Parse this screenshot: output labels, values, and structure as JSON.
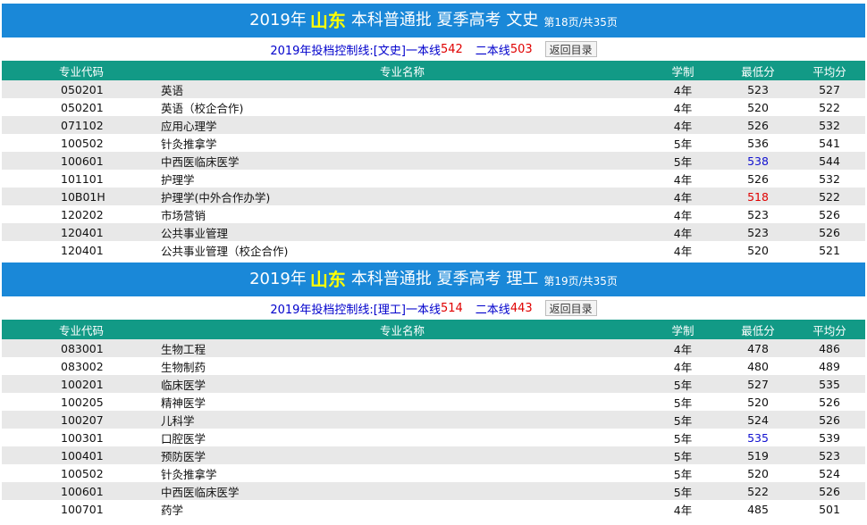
{
  "sections": [
    {
      "title": {
        "year": "2019年",
        "province": "山东",
        "rest": "本科普通批 夏季高考 文史",
        "page_info": "第18页/共35页"
      },
      "control": {
        "label": "2019年投档控制线:",
        "category": "[文史]",
        "line1_label": "一本线",
        "line1_value": "542",
        "line2_label": "二本线",
        "line2_value": "503"
      },
      "back_label": "返回目录",
      "headers": {
        "code": "专业代码",
        "name": "专业名称",
        "years": "学制",
        "min": "最低分",
        "avg": "平均分"
      },
      "rows": [
        {
          "code": "050201",
          "name": "英语",
          "years": "4年",
          "min": "523",
          "avg": "527",
          "min_color": ""
        },
        {
          "code": "050201",
          "name": "英语（校企合作)",
          "years": "4年",
          "min": "520",
          "avg": "522",
          "min_color": ""
        },
        {
          "code": "071102",
          "name": "应用心理学",
          "years": "4年",
          "min": "526",
          "avg": "532",
          "min_color": ""
        },
        {
          "code": "100502",
          "name": "针灸推拿学",
          "years": "5年",
          "min": "536",
          "avg": "541",
          "min_color": ""
        },
        {
          "code": "100601",
          "name": "中西医临床医学",
          "years": "5年",
          "min": "538",
          "avg": "544",
          "min_color": "blue"
        },
        {
          "code": "101101",
          "name": "护理学",
          "years": "4年",
          "min": "526",
          "avg": "532",
          "min_color": ""
        },
        {
          "code": "10B01H",
          "name": "护理学(中外合作办学)",
          "years": "4年",
          "min": "518",
          "avg": "522",
          "min_color": "red"
        },
        {
          "code": "120202",
          "name": "市场营销",
          "years": "4年",
          "min": "523",
          "avg": "526",
          "min_color": ""
        },
        {
          "code": "120401",
          "name": "公共事业管理",
          "years": "4年",
          "min": "523",
          "avg": "526",
          "min_color": ""
        },
        {
          "code": "120401",
          "name": "公共事业管理（校企合作)",
          "years": "4年",
          "min": "520",
          "avg": "521",
          "min_color": ""
        }
      ]
    },
    {
      "title": {
        "year": "2019年",
        "province": "山东",
        "rest": "本科普通批 夏季高考 理工",
        "page_info": "第19页/共35页"
      },
      "control": {
        "label": "2019年投档控制线:",
        "category": "[理工]",
        "line1_label": "一本线",
        "line1_value": "514",
        "line2_label": "二本线",
        "line2_value": "443"
      },
      "back_label": "返回目录",
      "headers": {
        "code": "专业代码",
        "name": "专业名称",
        "years": "学制",
        "min": "最低分",
        "avg": "平均分"
      },
      "rows": [
        {
          "code": "083001",
          "name": "生物工程",
          "years": "4年",
          "min": "478",
          "avg": "486",
          "min_color": ""
        },
        {
          "code": "083002",
          "name": "生物制药",
          "years": "4年",
          "min": "480",
          "avg": "489",
          "min_color": ""
        },
        {
          "code": "100201",
          "name": "临床医学",
          "years": "5年",
          "min": "527",
          "avg": "535",
          "min_color": ""
        },
        {
          "code": "100205",
          "name": "精神医学",
          "years": "5年",
          "min": "520",
          "avg": "526",
          "min_color": ""
        },
        {
          "code": "100207",
          "name": "儿科学",
          "years": "5年",
          "min": "524",
          "avg": "526",
          "min_color": ""
        },
        {
          "code": "100301",
          "name": "口腔医学",
          "years": "5年",
          "min": "535",
          "avg": "539",
          "min_color": "blue"
        },
        {
          "code": "100401",
          "name": "预防医学",
          "years": "5年",
          "min": "519",
          "avg": "523",
          "min_color": ""
        },
        {
          "code": "100502",
          "name": "针灸推拿学",
          "years": "5年",
          "min": "520",
          "avg": "524",
          "min_color": ""
        },
        {
          "code": "100601",
          "name": "中西医临床医学",
          "years": "5年",
          "min": "522",
          "avg": "526",
          "min_color": ""
        },
        {
          "code": "100701",
          "name": "药学",
          "years": "4年",
          "min": "485",
          "avg": "501",
          "min_color": ""
        }
      ]
    }
  ]
}
